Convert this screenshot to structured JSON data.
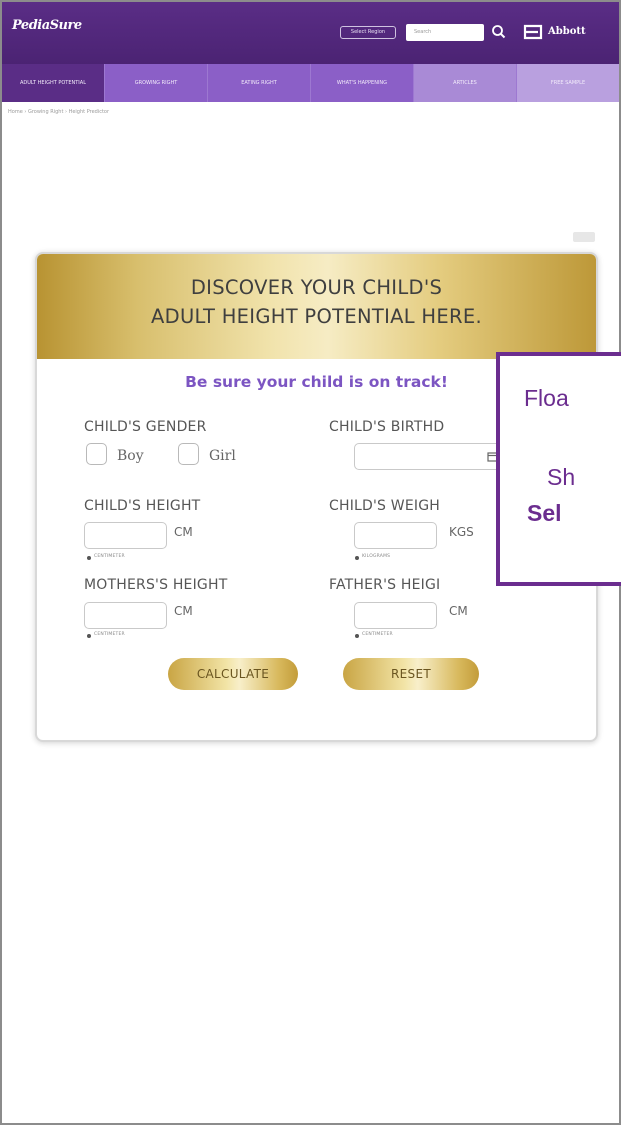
{
  "header": {
    "logo": "PediaSure",
    "chip_label": "Select Region",
    "search_placeholder": "Search",
    "brand": "Abbott"
  },
  "nav": {
    "items": [
      {
        "label": "ADULT HEIGHT POTENTIAL"
      },
      {
        "label": "GROWING RIGHT"
      },
      {
        "label": "EATING RIGHT"
      },
      {
        "label": "WHAT'S HAPPENING"
      },
      {
        "label": "ARTICLES"
      },
      {
        "label": "FREE SAMPLE"
      }
    ]
  },
  "breadcrumb": "Home  ›  Growing Right  ›  Height Predictor",
  "modal": {
    "title_line1": "DISCOVER YOUR CHILD'S",
    "title_line2": "ADULT HEIGHT POTENTIAL HERE.",
    "tagline": "Be sure your child is on track!",
    "gender_label": "CHILD'S GENDER",
    "gender_options": [
      "Boy",
      "Girl"
    ],
    "birthdate_label": "CHILD'S BIRTHD",
    "height_label": "CHILD'S HEIGHT",
    "height_unit": "CM",
    "height_unit_option": "CENTIMETER",
    "weight_label": "CHILD'S WEIGH",
    "weight_unit": "KGS",
    "weight_unit_option": "KILOGRAMS",
    "mother_label": "MOTHERS'S HEIGHT",
    "mother_unit": "CM",
    "mother_unit_option": "CENTIMETER",
    "father_label": "FATHER'S HEIGI",
    "father_unit": "CM",
    "father_unit_option": "CENTIMETER",
    "calculate_label": "CALCULATE",
    "reset_label": "RESET"
  },
  "callout": {
    "line1": "Floa",
    "line2": "Sh",
    "line3": "Sel"
  },
  "colors": {
    "header_purple": "#4b2373",
    "nav_purple": "#8b5fc7",
    "tagline_purple": "#7c55c2",
    "gold": "#d8bf6d",
    "callout_border": "#6b2d8f"
  }
}
